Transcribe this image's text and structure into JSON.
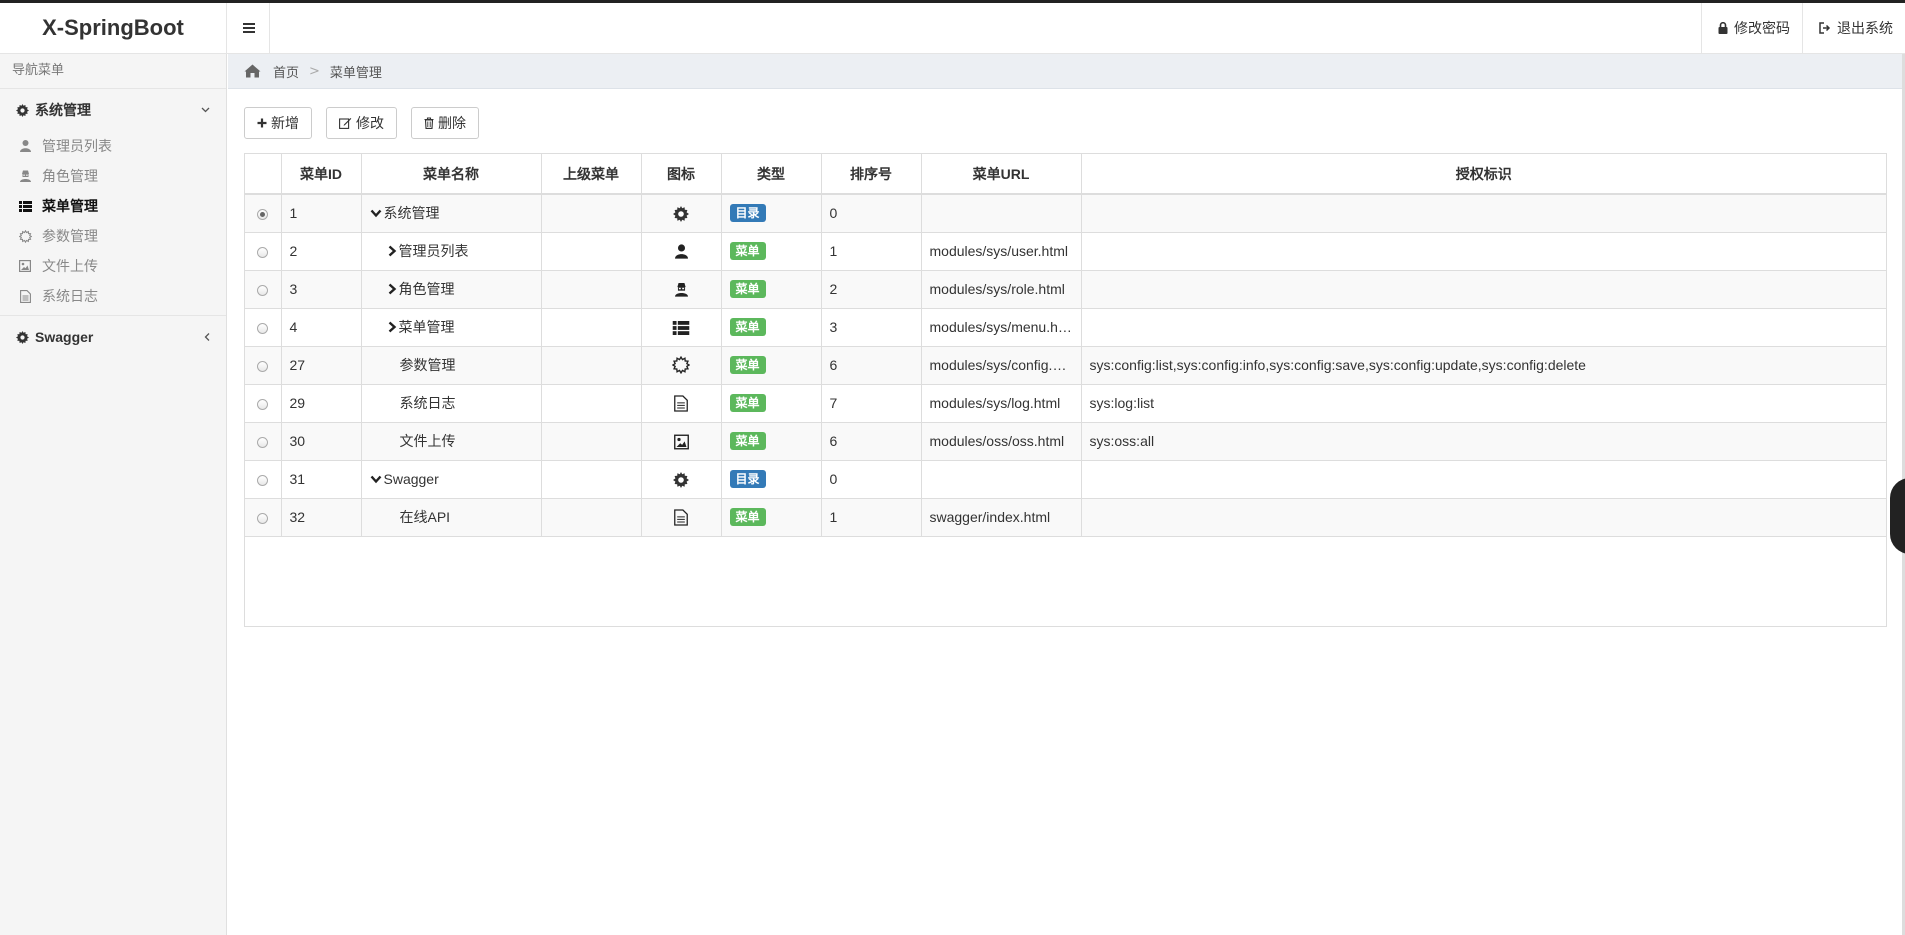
{
  "app": {
    "brand": "X-SpringBoot",
    "header_links": [
      {
        "label": "修改密码",
        "icon": "lock-icon"
      },
      {
        "label": "退出系统",
        "icon": "sign-out-icon"
      }
    ]
  },
  "sidebar": {
    "title": "导航菜单",
    "groups": [
      {
        "label": "系统管理",
        "icon": "gear-icon",
        "expanded": true,
        "items": [
          {
            "label": "管理员列表",
            "icon": "user-icon"
          },
          {
            "label": "角色管理",
            "icon": "user-secret-icon"
          },
          {
            "label": "菜单管理",
            "icon": "list-icon",
            "active": true
          },
          {
            "label": "参数管理",
            "icon": "sun-icon"
          },
          {
            "label": "文件上传",
            "icon": "image-icon"
          },
          {
            "label": "系统日志",
            "icon": "file-text-icon"
          }
        ]
      },
      {
        "label": "Swagger",
        "icon": "gear-icon",
        "expanded": false,
        "items": []
      }
    ]
  },
  "breadcrumb": {
    "home": "首页",
    "current": "菜单管理"
  },
  "toolbar": {
    "add": "新增",
    "edit": "修改",
    "delete": "删除"
  },
  "table": {
    "headers": [
      "菜单ID",
      "菜单名称",
      "上级菜单",
      "图标",
      "类型",
      "排序号",
      "菜单URL",
      "授权标识"
    ],
    "rows": [
      {
        "id": "1",
        "name": "系统管理",
        "parent": "",
        "icon": "gear-icon",
        "type": "目录",
        "order": "0",
        "url": "",
        "perms": "",
        "checked": true,
        "expand": "down",
        "indent": 0
      },
      {
        "id": "2",
        "name": "管理员列表",
        "parent": "",
        "icon": "user-icon",
        "type": "菜单",
        "order": "1",
        "url": "modules/sys/user.html",
        "perms": "",
        "expand": "right",
        "indent": 1
      },
      {
        "id": "3",
        "name": "角色管理",
        "parent": "",
        "icon": "user-secret-icon",
        "type": "菜单",
        "order": "2",
        "url": "modules/sys/role.html",
        "perms": "",
        "expand": "right",
        "indent": 1
      },
      {
        "id": "4",
        "name": "菜单管理",
        "parent": "",
        "icon": "list-icon",
        "type": "菜单",
        "order": "3",
        "url": "modules/sys/menu.h…",
        "perms": "",
        "expand": "right",
        "indent": 1
      },
      {
        "id": "27",
        "name": "参数管理",
        "parent": "",
        "icon": "sun-icon",
        "type": "菜单",
        "order": "6",
        "url": "modules/sys/config.…",
        "perms": "sys:config:list,sys:config:info,sys:config:save,sys:config:update,sys:config:delete",
        "expand": "none",
        "indent": 1
      },
      {
        "id": "29",
        "name": "系统日志",
        "parent": "",
        "icon": "file-text-icon",
        "type": "菜单",
        "order": "7",
        "url": "modules/sys/log.html",
        "perms": "sys:log:list",
        "expand": "none",
        "indent": 1
      },
      {
        "id": "30",
        "name": "文件上传",
        "parent": "",
        "icon": "image-icon",
        "type": "菜单",
        "order": "6",
        "url": "modules/oss/oss.html",
        "perms": "sys:oss:all",
        "expand": "none",
        "indent": 1
      },
      {
        "id": "31",
        "name": "Swagger",
        "parent": "",
        "icon": "gear-icon",
        "type": "目录",
        "order": "0",
        "url": "",
        "perms": "",
        "expand": "down",
        "indent": 0
      },
      {
        "id": "32",
        "name": "在线API",
        "parent": "",
        "icon": "file-text-icon",
        "type": "菜单",
        "order": "1",
        "url": "swagger/index.html",
        "perms": "",
        "expand": "none",
        "indent": 1
      }
    ]
  },
  "colors": {
    "badge_dir": "#337ab7",
    "badge_menu": "#5cb85c"
  }
}
